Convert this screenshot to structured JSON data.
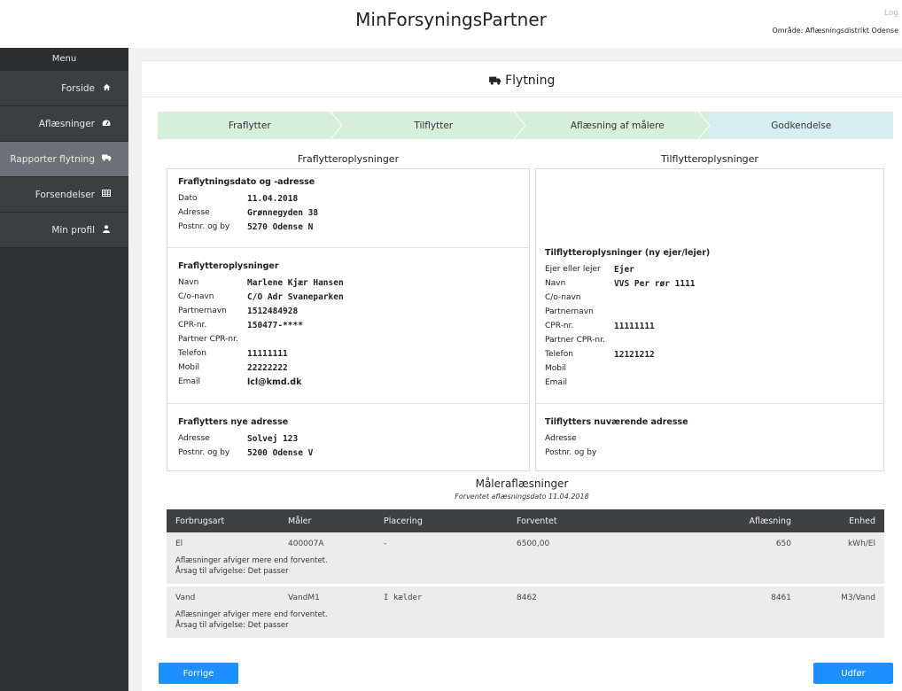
{
  "header": {
    "title": "MinForsyningsPartner",
    "logout": "Log",
    "area": "Område: Aflæsningsdistrikt Odense"
  },
  "sidebar": {
    "menu_label": "Menu",
    "items": [
      {
        "label": "Forside",
        "icon": "home-icon"
      },
      {
        "label": "Aflæsninger",
        "icon": "gauge-icon"
      },
      {
        "label": "Rapporter flytning",
        "icon": "truck-icon"
      },
      {
        "label": "Forsendelser",
        "icon": "table-icon"
      },
      {
        "label": "Min profil",
        "icon": "user-icon"
      }
    ]
  },
  "page": {
    "title": "Flytning",
    "title_icon": "truck-icon"
  },
  "steps": [
    "Fraflytter",
    "Tilflytter",
    "Aflæsning af målere",
    "Godkendelse"
  ],
  "left": {
    "column_title": "Fraflytteroplysninger",
    "move": {
      "heading": "Fraflytningsdato og -adresse",
      "rows": [
        {
          "label": "Dato",
          "value": "11.04.2018"
        },
        {
          "label": "Adresse",
          "value": "Grønnegyden 38"
        },
        {
          "label": "Postnr. og by",
          "value": "5270 Odense N"
        }
      ]
    },
    "info": {
      "heading": "Fraflytteroplysninger",
      "rows": [
        {
          "label": "Navn",
          "value": "Marlene Kjær Hansen"
        },
        {
          "label": "C/o-navn",
          "value": "C/O Adr Svaneparken"
        },
        {
          "label": "Partnernavn",
          "value": "1512484928"
        },
        {
          "label": "CPR-nr.",
          "value": "150477-****"
        },
        {
          "label": "Partner CPR-nr.",
          "value": ""
        },
        {
          "label": "Telefon",
          "value": "11111111"
        },
        {
          "label": "Mobil",
          "value": "22222222"
        },
        {
          "label": "Email",
          "value": "lcl@kmd.dk"
        }
      ]
    },
    "new_address": {
      "heading": "Fraflytters nye adresse",
      "rows": [
        {
          "label": "Adresse",
          "value": "Solvej 123"
        },
        {
          "label": "Postnr. og by",
          "value": "5200 Odense V"
        }
      ]
    }
  },
  "right": {
    "column_title": "Tilflytteroplysninger",
    "info": {
      "heading": "Tilflytteroplysninger (ny ejer/lejer)",
      "rows": [
        {
          "label": "Ejer eller lejer",
          "value": "Ejer"
        },
        {
          "label": "Navn",
          "value": "VVS Per rør 1111"
        },
        {
          "label": "C/o-navn",
          "value": ""
        },
        {
          "label": "Partnernavn",
          "value": ""
        },
        {
          "label": "CPR-nr.",
          "value": "11111111"
        },
        {
          "label": "Partner CPR-nr.",
          "value": ""
        },
        {
          "label": "Telefon",
          "value": "12121212"
        },
        {
          "label": "Mobil",
          "value": ""
        },
        {
          "label": "Email",
          "value": ""
        }
      ]
    },
    "current_address": {
      "heading": "Tilflytters nuværende adresse",
      "rows": [
        {
          "label": "Adresse",
          "value": ""
        },
        {
          "label": "Postnr. og by",
          "value": ""
        }
      ]
    }
  },
  "meters": {
    "title": "Måleraflæsninger",
    "subtitle": "Forventet aflæsningsdato 11.04.2018",
    "columns": [
      "Forbrugsart",
      "Måler",
      "Placering",
      "Forventet",
      "Aflæsning",
      "Enhed"
    ],
    "rows": [
      {
        "cells": [
          "El",
          "400007A",
          "-",
          "6500,00",
          "650",
          "kWh/El"
        ],
        "note1": "Aflæsninger afviger mere end forventet.",
        "note2": "Årsag til afvigelse: Det passer"
      },
      {
        "cells": [
          "Vand",
          "VandM1",
          "I kælder",
          "8462",
          "8461",
          "M3/Vand"
        ],
        "note1": "Aflæsninger afviger mere end forventet.",
        "note2": "Årsag til afvigelse: Det passer"
      }
    ]
  },
  "buttons": {
    "prev": "Forrige",
    "submit": "Udfør"
  },
  "colors": {
    "sidebar": "#2f3337",
    "sidebar_active": "#6b7177",
    "step_green": "#d6eedc",
    "step_blue": "#d6eef0",
    "table_header": "#3d4146",
    "button": "#1e8fff"
  }
}
